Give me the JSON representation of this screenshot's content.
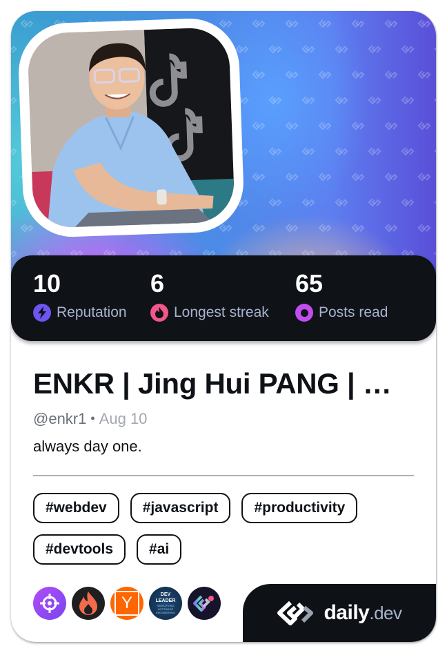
{
  "profile": {
    "name": "ENKR | Jing Hui PANG | …",
    "handle": "@enkr1",
    "separator": "•",
    "joined": "Aug 10",
    "bio": "always day one.",
    "avatar_icon": "profile-photo"
  },
  "stats": [
    {
      "value": "10",
      "label": "Reputation",
      "icon": "lightning-icon",
      "color": "#6e54f1"
    },
    {
      "value": "6",
      "label": "Longest streak",
      "icon": "flame-icon",
      "color": "#f2578a"
    },
    {
      "value": "65",
      "label": "Posts read",
      "icon": "ring-icon",
      "color": "#c14df0"
    }
  ],
  "tags": [
    "#webdev",
    "#javascript",
    "#productivity",
    "#devtools",
    "#ai"
  ],
  "sources": [
    {
      "name": "crosshair-source",
      "bg": "#9a47f5"
    },
    {
      "name": "flame-source",
      "bg": "#1f1f22"
    },
    {
      "name": "hacker-news-source",
      "bg": "#ff6600",
      "letter": "Y"
    },
    {
      "name": "dev-leader-source",
      "bg": "#15304f",
      "lines": [
        "DEV",
        "LEADER",
        "SIMPLIFYING",
        "SOFTWARE",
        "ENGINEERING"
      ]
    },
    {
      "name": "daily-dev-source",
      "bg": "#15142a"
    }
  ],
  "brand": {
    "name": "daily",
    "tld": ".dev"
  },
  "colors": {
    "dark": "#0e1217",
    "label": "#a8b3cf",
    "accent_purple": "#6e54f1",
    "accent_pink": "#f2578a",
    "accent_magenta": "#c14df0"
  }
}
